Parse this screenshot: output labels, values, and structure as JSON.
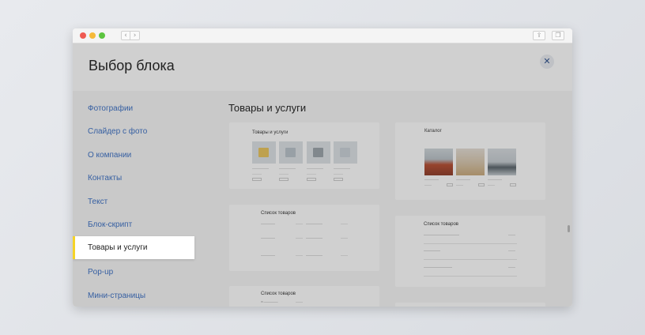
{
  "modal": {
    "title": "Выбор блока",
    "close_icon": "close-icon"
  },
  "sidebar": {
    "items": [
      {
        "label": "Фотографии",
        "active": false
      },
      {
        "label": "Слайдер с фото",
        "active": false
      },
      {
        "label": "О компании",
        "active": false
      },
      {
        "label": "Контакты",
        "active": false
      },
      {
        "label": "Текст",
        "active": false
      },
      {
        "label": "Блок-скрипт",
        "active": false
      },
      {
        "label": "Товары и услуги",
        "active": true
      },
      {
        "label": "Pop-up",
        "active": false
      },
      {
        "label": "Мини-страницы",
        "active": false
      }
    ]
  },
  "section": {
    "title": "Товары и услуги"
  },
  "cards": {
    "products": {
      "title": "Товары и услуги"
    },
    "catalog": {
      "title": "Каталог"
    },
    "list1": {
      "title": "Список товаров"
    },
    "list2": {
      "title": "Список товаров"
    },
    "list3": {
      "title": "Список товаров"
    }
  },
  "colors": {
    "accent": "#f5d327",
    "link": "#3a6fc4",
    "close": "#2c4f8c"
  }
}
